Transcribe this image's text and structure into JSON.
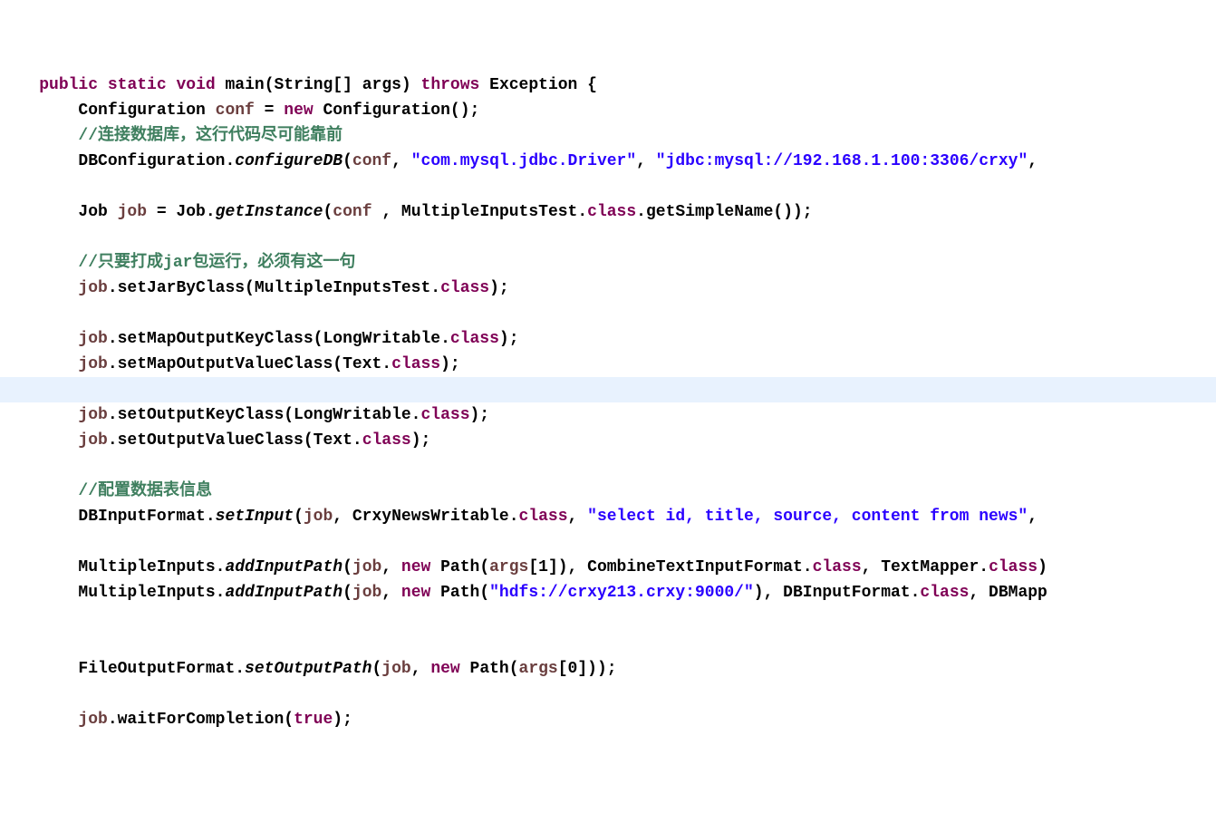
{
  "lines": [
    {
      "cls": "",
      "tokens": [
        {
          "t": "    ",
          "c": "kw-black"
        },
        {
          "t": "public",
          "c": "kw-purple"
        },
        {
          "t": " ",
          "c": "kw-black"
        },
        {
          "t": "static",
          "c": "kw-purple"
        },
        {
          "t": " ",
          "c": "kw-black"
        },
        {
          "t": "void",
          "c": "kw-purple"
        },
        {
          "t": " main(String[] args) ",
          "c": "kw-black"
        },
        {
          "t": "throws",
          "c": "kw-purple"
        },
        {
          "t": " Exception {",
          "c": "kw-black"
        }
      ]
    },
    {
      "cls": "",
      "tokens": [
        {
          "t": "        Configuration ",
          "c": "kw-black"
        },
        {
          "t": "conf",
          "c": "field-brown"
        },
        {
          "t": " = ",
          "c": "kw-black"
        },
        {
          "t": "new",
          "c": "kw-purple"
        },
        {
          "t": " Configuration();",
          "c": "kw-black"
        }
      ]
    },
    {
      "cls": "",
      "tokens": [
        {
          "t": "        ",
          "c": "kw-black"
        },
        {
          "t": "//连接数据库，这行代码尽可能靠前",
          "c": "comment"
        }
      ]
    },
    {
      "cls": "",
      "tokens": [
        {
          "t": "        DBConfiguration.",
          "c": "kw-black"
        },
        {
          "t": "configureDB",
          "c": "method-italic"
        },
        {
          "t": "(",
          "c": "kw-black"
        },
        {
          "t": "conf",
          "c": "field-brown"
        },
        {
          "t": ", ",
          "c": "kw-black"
        },
        {
          "t": "\"com.mysql.jdbc.Driver\"",
          "c": "string"
        },
        {
          "t": ", ",
          "c": "kw-black"
        },
        {
          "t": "\"jdbc:mysql://192.168.1.100:3306/crxy\"",
          "c": "string"
        },
        {
          "t": ",",
          "c": "kw-black"
        }
      ]
    },
    {
      "cls": "",
      "tokens": [
        {
          "t": "        ",
          "c": "kw-black"
        }
      ]
    },
    {
      "cls": "",
      "tokens": [
        {
          "t": "        Job ",
          "c": "kw-black"
        },
        {
          "t": "job",
          "c": "field-brown"
        },
        {
          "t": " = Job.",
          "c": "kw-black"
        },
        {
          "t": "getInstance",
          "c": "method-italic"
        },
        {
          "t": "(",
          "c": "kw-black"
        },
        {
          "t": "conf",
          "c": "field-brown"
        },
        {
          "t": " , MultipleInputsTest.",
          "c": "kw-black"
        },
        {
          "t": "class",
          "c": "kw-purple"
        },
        {
          "t": ".getSimpleName());",
          "c": "kw-black"
        }
      ]
    },
    {
      "cls": "",
      "tokens": [
        {
          "t": "        ",
          "c": "kw-black"
        }
      ]
    },
    {
      "cls": "",
      "tokens": [
        {
          "t": "        ",
          "c": "kw-black"
        },
        {
          "t": "//只要打成jar包运行，必须有这一句",
          "c": "comment"
        }
      ]
    },
    {
      "cls": "",
      "tokens": [
        {
          "t": "        ",
          "c": "kw-black"
        },
        {
          "t": "job",
          "c": "field-brown"
        },
        {
          "t": ".setJarByClass(MultipleInputsTest.",
          "c": "kw-black"
        },
        {
          "t": "class",
          "c": "kw-purple"
        },
        {
          "t": ");",
          "c": "kw-black"
        }
      ]
    },
    {
      "cls": "",
      "tokens": [
        {
          "t": "        ",
          "c": "kw-black"
        }
      ]
    },
    {
      "cls": "",
      "tokens": [
        {
          "t": "        ",
          "c": "kw-black"
        },
        {
          "t": "job",
          "c": "field-brown"
        },
        {
          "t": ".setMapOutputKeyClass(LongWritable.",
          "c": "kw-black"
        },
        {
          "t": "class",
          "c": "kw-purple"
        },
        {
          "t": ");",
          "c": "kw-black"
        }
      ]
    },
    {
      "cls": "",
      "tokens": [
        {
          "t": "        ",
          "c": "kw-black"
        },
        {
          "t": "job",
          "c": "field-brown"
        },
        {
          "t": ".setMapOutputValueClass(Text.",
          "c": "kw-black"
        },
        {
          "t": "class",
          "c": "kw-purple"
        },
        {
          "t": ");",
          "c": "kw-black"
        }
      ]
    },
    {
      "cls": "highlighted",
      "tokens": [
        {
          "t": "        ",
          "c": "kw-black"
        }
      ]
    },
    {
      "cls": "",
      "tokens": [
        {
          "t": "        ",
          "c": "kw-black"
        },
        {
          "t": "job",
          "c": "field-brown"
        },
        {
          "t": ".setOutputKeyClass(LongWritable.",
          "c": "kw-black"
        },
        {
          "t": "class",
          "c": "kw-purple"
        },
        {
          "t": ");",
          "c": "kw-black"
        }
      ]
    },
    {
      "cls": "",
      "tokens": [
        {
          "t": "        ",
          "c": "kw-black"
        },
        {
          "t": "job",
          "c": "field-brown"
        },
        {
          "t": ".setOutputValueClass(Text.",
          "c": "kw-black"
        },
        {
          "t": "class",
          "c": "kw-purple"
        },
        {
          "t": ");",
          "c": "kw-black"
        }
      ]
    },
    {
      "cls": "",
      "tokens": [
        {
          "t": "        ",
          "c": "kw-black"
        }
      ]
    },
    {
      "cls": "",
      "tokens": [
        {
          "t": "        ",
          "c": "kw-black"
        },
        {
          "t": "//配置数据表信息",
          "c": "comment"
        }
      ]
    },
    {
      "cls": "",
      "tokens": [
        {
          "t": "        DBInputFormat.",
          "c": "kw-black"
        },
        {
          "t": "setInput",
          "c": "method-italic"
        },
        {
          "t": "(",
          "c": "kw-black"
        },
        {
          "t": "job",
          "c": "field-brown"
        },
        {
          "t": ", CrxyNewsWritable.",
          "c": "kw-black"
        },
        {
          "t": "class",
          "c": "kw-purple"
        },
        {
          "t": ", ",
          "c": "kw-black"
        },
        {
          "t": "\"select id, title, source, content from news\"",
          "c": "string"
        },
        {
          "t": ",",
          "c": "kw-black"
        }
      ]
    },
    {
      "cls": "",
      "tokens": [
        {
          "t": "        ",
          "c": "kw-black"
        }
      ]
    },
    {
      "cls": "",
      "tokens": [
        {
          "t": "        MultipleInputs.",
          "c": "kw-black"
        },
        {
          "t": "addInputPath",
          "c": "method-italic"
        },
        {
          "t": "(",
          "c": "kw-black"
        },
        {
          "t": "job",
          "c": "field-brown"
        },
        {
          "t": ", ",
          "c": "kw-black"
        },
        {
          "t": "new",
          "c": "kw-purple"
        },
        {
          "t": " Path(",
          "c": "kw-black"
        },
        {
          "t": "args",
          "c": "field-brown"
        },
        {
          "t": "[1]), CombineTextInputFormat.",
          "c": "kw-black"
        },
        {
          "t": "class",
          "c": "kw-purple"
        },
        {
          "t": ", TextMapper.",
          "c": "kw-black"
        },
        {
          "t": "class",
          "c": "kw-purple"
        },
        {
          "t": ")",
          "c": "kw-black"
        }
      ]
    },
    {
      "cls": "",
      "tokens": [
        {
          "t": "        MultipleInputs.",
          "c": "kw-black"
        },
        {
          "t": "addInputPath",
          "c": "method-italic"
        },
        {
          "t": "(",
          "c": "kw-black"
        },
        {
          "t": "job",
          "c": "field-brown"
        },
        {
          "t": ", ",
          "c": "kw-black"
        },
        {
          "t": "new",
          "c": "kw-purple"
        },
        {
          "t": " Path(",
          "c": "kw-black"
        },
        {
          "t": "\"hdfs://crxy213.crxy:9000/\"",
          "c": "string"
        },
        {
          "t": "), DBInputFormat.",
          "c": "kw-black"
        },
        {
          "t": "class",
          "c": "kw-purple"
        },
        {
          "t": ", DBMapp",
          "c": "kw-black"
        }
      ]
    },
    {
      "cls": "",
      "tokens": [
        {
          "t": "        ",
          "c": "kw-black"
        }
      ]
    },
    {
      "cls": "",
      "tokens": [
        {
          "t": "        ",
          "c": "kw-black"
        }
      ]
    },
    {
      "cls": "",
      "tokens": [
        {
          "t": "        FileOutputFormat.",
          "c": "kw-black"
        },
        {
          "t": "setOutputPath",
          "c": "method-italic"
        },
        {
          "t": "(",
          "c": "kw-black"
        },
        {
          "t": "job",
          "c": "field-brown"
        },
        {
          "t": ", ",
          "c": "kw-black"
        },
        {
          "t": "new",
          "c": "kw-purple"
        },
        {
          "t": " Path(",
          "c": "kw-black"
        },
        {
          "t": "args",
          "c": "field-brown"
        },
        {
          "t": "[0]));",
          "c": "kw-black"
        }
      ]
    },
    {
      "cls": "",
      "tokens": [
        {
          "t": "        ",
          "c": "kw-black"
        }
      ]
    },
    {
      "cls": "",
      "tokens": [
        {
          "t": "        ",
          "c": "kw-black"
        },
        {
          "t": "job",
          "c": "field-brown"
        },
        {
          "t": ".waitForCompletion(",
          "c": "kw-black"
        },
        {
          "t": "true",
          "c": "kw-purple"
        },
        {
          "t": ");",
          "c": "kw-black"
        }
      ]
    }
  ]
}
